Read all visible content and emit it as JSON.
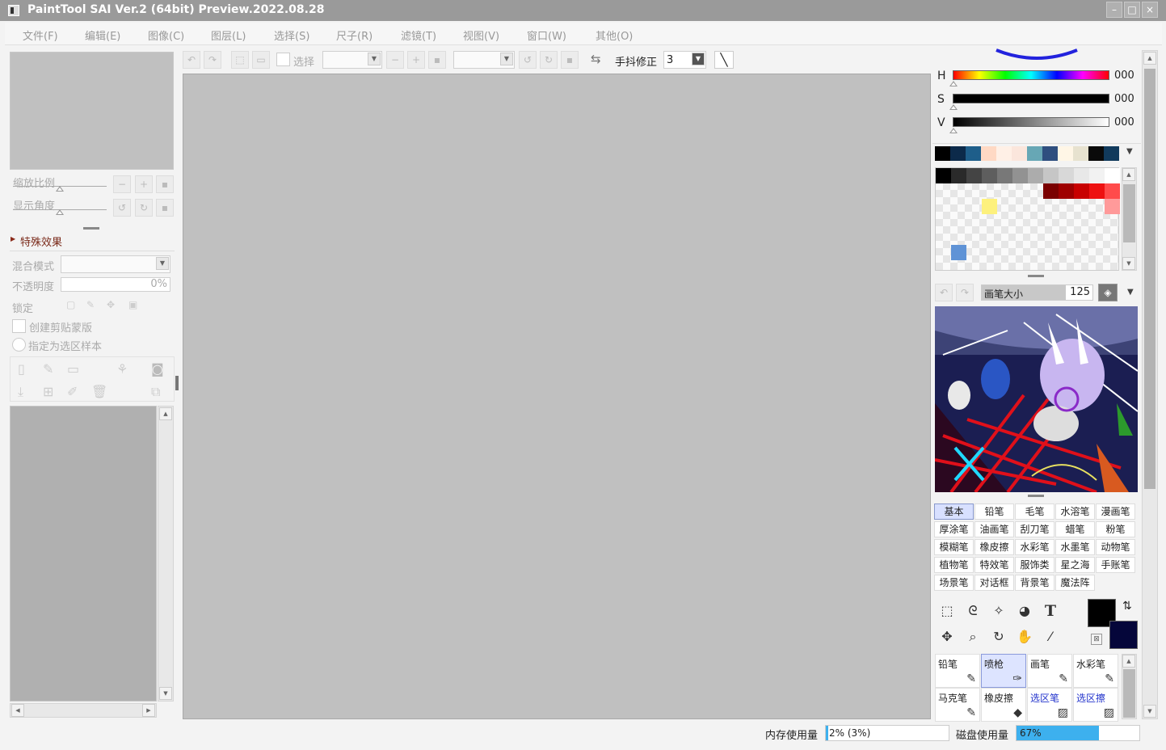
{
  "window": {
    "title": "PaintTool SAI Ver.2 (64bit) Preview.2022.08.28",
    "minimize": "–",
    "maximize": "□",
    "close": "×"
  },
  "menu": [
    "文件(F)",
    "编辑(E)",
    "图像(C)",
    "图层(L)",
    "选择(S)",
    "尺子(R)",
    "滤镜(T)",
    "视图(V)",
    "窗口(W)",
    "其他(O)"
  ],
  "navigator": {
    "zoom_label": "缩放比例",
    "angle_label": "显示角度"
  },
  "layer_panel": {
    "effects_label": "特殊效果",
    "blend_label": "混合模式",
    "blend_value": "",
    "opacity_label": "不透明度",
    "opacity_value": "0%",
    "lock_label": "锁定",
    "clip_label": "创建剪贴蒙版",
    "sample_label": "指定为选区样本"
  },
  "toolbar": {
    "select_label": "选择",
    "stabilizer_label": "手抖修正",
    "stabilizer_value": "3"
  },
  "color": {
    "h_label": "H",
    "h_value": "000",
    "s_label": "S",
    "s_value": "000",
    "v_label": "V",
    "v_value": "000",
    "recent": [
      "#000000",
      "#0c2a4a",
      "#1e5e8a",
      "#ffd9c4",
      "#fff0e6",
      "#fbe6dc",
      "#67a7b5",
      "#2f4f7f",
      "#fff6e6",
      "#e7e2cf",
      "#0a0a0a",
      "#113a5c"
    ],
    "grays": [
      "#000000",
      "#2a2a2a",
      "#444444",
      "#5e5e5e",
      "#787878",
      "#929292",
      "#acacac",
      "#c6c6c6",
      "#d8d8d8",
      "#e8e8e8",
      "#f2f2f2",
      "#ffffff"
    ],
    "reds": [
      "#7a0000",
      "#9e0000",
      "#c80000",
      "#ee1111",
      "#ff4b4b"
    ],
    "pink": "#ff9a9a",
    "yellow": "#fdf17d",
    "blue": "#5f93d6",
    "primary": "#000000",
    "secondary": "#05063a"
  },
  "brush_size": {
    "label": "画笔大小",
    "value": "125"
  },
  "brush_categories": [
    "基本",
    "铅笔",
    "毛笔",
    "水溶笔",
    "漫画笔",
    "厚涂笔",
    "油画笔",
    "刮刀笔",
    "蜡笔",
    "粉笔",
    "模糊笔",
    "橡皮擦",
    "水彩笔",
    "水墨笔",
    "动物笔",
    "植物笔",
    "特效笔",
    "服饰类",
    "星之海",
    "手账笔",
    "场景笔",
    "对话框",
    "背景笔",
    "魔法阵"
  ],
  "tools": [
    {
      "icon": "selection-rect-icon",
      "glyph": "⬚"
    },
    {
      "icon": "lasso-icon",
      "glyph": "ᘓ"
    },
    {
      "icon": "magic-wand-icon",
      "glyph": "✧"
    },
    {
      "icon": "shape-icon",
      "glyph": "◕"
    },
    {
      "icon": "text-icon",
      "glyph": "T"
    },
    {
      "icon": "move-icon",
      "glyph": "✥"
    },
    {
      "icon": "zoom-icon",
      "glyph": "⌕"
    },
    {
      "icon": "rotate-icon",
      "glyph": "↻"
    },
    {
      "icon": "hand-icon",
      "glyph": "✋"
    },
    {
      "icon": "eyedropper-icon",
      "glyph": "⁄"
    }
  ],
  "brush_slots": [
    {
      "name": "铅笔",
      "icon": "pencil-icon",
      "glyph": "✎",
      "link": false
    },
    {
      "name": "喷枪",
      "icon": "airbrush-icon",
      "glyph": "✑",
      "link": false
    },
    {
      "name": "画笔",
      "icon": "brush-icon",
      "glyph": "✎",
      "link": false
    },
    {
      "name": "水彩笔",
      "icon": "watercolor-icon",
      "glyph": "✎",
      "link": false
    },
    {
      "name": "马克笔",
      "icon": "marker-icon",
      "glyph": "✎",
      "link": false
    },
    {
      "name": "橡皮擦",
      "icon": "eraser-icon",
      "glyph": "◆",
      "link": false
    },
    {
      "name": "选区笔",
      "icon": "select-pen-icon",
      "glyph": "▨",
      "link": true
    },
    {
      "name": "选区擦",
      "icon": "select-eraser-icon",
      "glyph": "▨",
      "link": true
    }
  ],
  "status": {
    "memory_label": "内存使用量",
    "memory_value": "2% (3%)",
    "memory_fraction": 0.02,
    "disk_label": "磁盘使用量",
    "disk_value": "67%",
    "disk_fraction": 0.67,
    "disk_color": "#3db0ee"
  }
}
